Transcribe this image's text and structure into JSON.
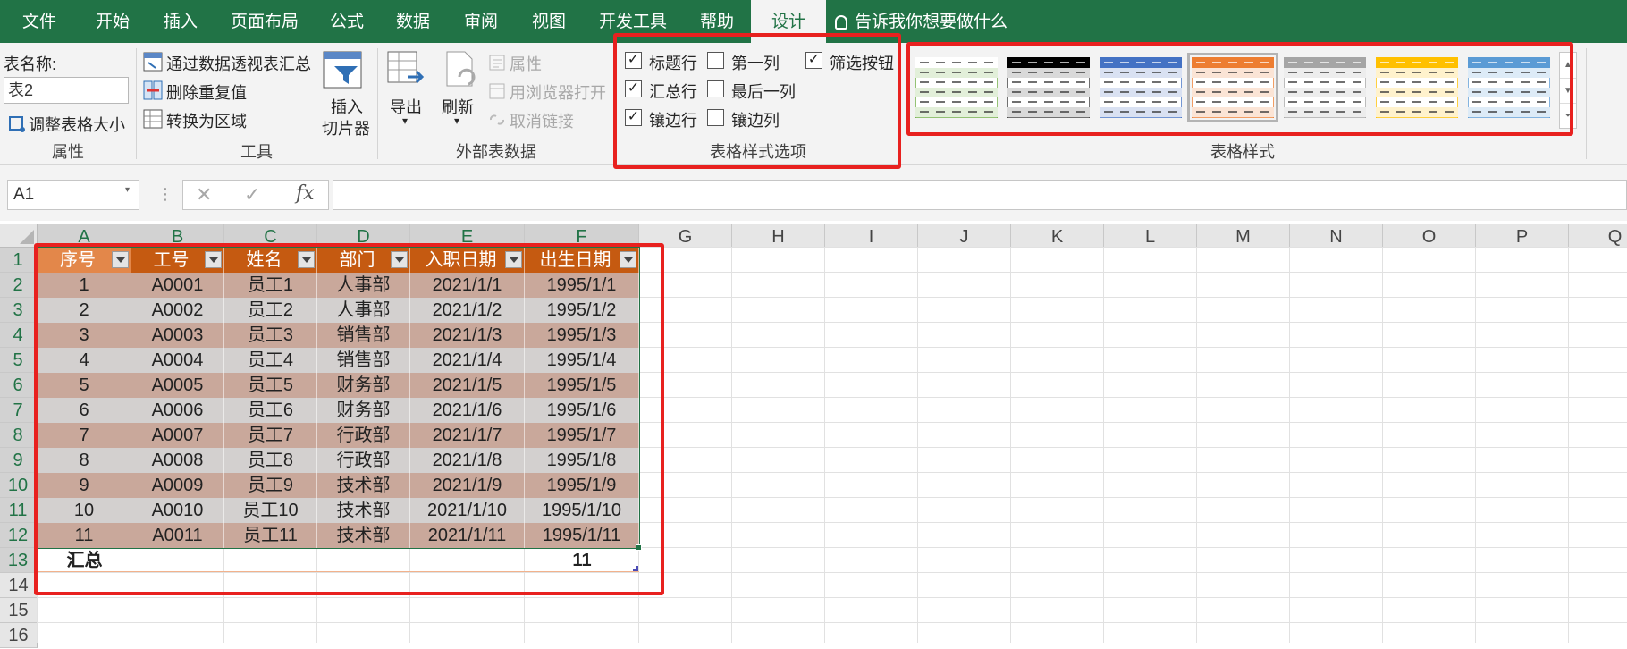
{
  "ribbon_tabs": [
    "文件",
    "开始",
    "插入",
    "页面布局",
    "公式",
    "数据",
    "审阅",
    "视图",
    "开发工具",
    "帮助",
    "设计"
  ],
  "tell_me": "告诉我你想要做什么",
  "properties": {
    "table_name_label": "表名称:",
    "table_name_value": "表2",
    "resize_label": "调整表格大小",
    "group_label": "属性"
  },
  "tools": {
    "pivot": "通过数据透视表汇总",
    "remove_dup": "删除重复值",
    "convert": "转换为区域",
    "slicer_line1": "插入",
    "slicer_line2": "切片器",
    "group_label": "工具"
  },
  "external": {
    "export": "导出",
    "refresh": "刷新",
    "properties": "属性",
    "open_browser": "用浏览器打开",
    "unlink": "取消链接",
    "group_label": "外部表数据"
  },
  "style_options": {
    "group_label": "表格样式选项",
    "options": [
      {
        "label": "标题行",
        "checked": true
      },
      {
        "label": "汇总行",
        "checked": true
      },
      {
        "label": "镶边行",
        "checked": true
      },
      {
        "label": "第一列",
        "checked": false
      },
      {
        "label": "最后一列",
        "checked": false
      },
      {
        "label": "镶边列",
        "checked": false
      },
      {
        "label": "筛选按钮",
        "checked": true
      }
    ]
  },
  "table_styles": {
    "group_label": "表格样式",
    "swatches": [
      {
        "name": "green",
        "head": "#ffffff",
        "band": "#e2efd9",
        "line": "#70ad47"
      },
      {
        "name": "black",
        "head": "#000000",
        "band": "#d9d9d9",
        "line": "#404040"
      },
      {
        "name": "blue",
        "head": "#4472c4",
        "band": "#d9e1f2",
        "line": "#4472c4"
      },
      {
        "name": "orange",
        "head": "#ed7d31",
        "band": "#fbe4d5",
        "line": "#ed7d31"
      },
      {
        "name": "gray",
        "head": "#a5a5a5",
        "band": "#ededed",
        "line": "#a5a5a5"
      },
      {
        "name": "gold",
        "head": "#ffc000",
        "band": "#fff2cc",
        "line": "#ffc000"
      },
      {
        "name": "lightblue",
        "head": "#5b9bd5",
        "band": "#ddebf7",
        "line": "#5b9bd5"
      }
    ]
  },
  "namebox": "A1",
  "columns": [
    "A",
    "B",
    "C",
    "D",
    "E",
    "F",
    "G",
    "H",
    "I",
    "J",
    "K",
    "L",
    "M",
    "N",
    "O",
    "P",
    "Q"
  ],
  "rows": [
    "1",
    "2",
    "3",
    "4",
    "5",
    "6",
    "7",
    "8",
    "9",
    "10",
    "11",
    "12",
    "13",
    "14",
    "15",
    "16"
  ],
  "table": {
    "headers": [
      "序号",
      "工号",
      "姓名",
      "部门",
      "入职日期",
      "出生日期"
    ],
    "rows": [
      [
        "1",
        "A0001",
        "员工1",
        "人事部",
        "2021/1/1",
        "1995/1/1"
      ],
      [
        "2",
        "A0002",
        "员工2",
        "人事部",
        "2021/1/2",
        "1995/1/2"
      ],
      [
        "3",
        "A0003",
        "员工3",
        "销售部",
        "2021/1/3",
        "1995/1/3"
      ],
      [
        "4",
        "A0004",
        "员工4",
        "销售部",
        "2021/1/4",
        "1995/1/4"
      ],
      [
        "5",
        "A0005",
        "员工5",
        "财务部",
        "2021/1/5",
        "1995/1/5"
      ],
      [
        "6",
        "A0006",
        "员工6",
        "财务部",
        "2021/1/6",
        "1995/1/6"
      ],
      [
        "7",
        "A0007",
        "员工7",
        "行政部",
        "2021/1/7",
        "1995/1/7"
      ],
      [
        "8",
        "A0008",
        "员工8",
        "行政部",
        "2021/1/8",
        "1995/1/8"
      ],
      [
        "9",
        "A0009",
        "员工9",
        "技术部",
        "2021/1/9",
        "1995/1/9"
      ],
      [
        "10",
        "A0010",
        "员工10",
        "技术部",
        "2021/1/10",
        "1995/1/10"
      ],
      [
        "11",
        "A0011",
        "员工11",
        "技术部",
        "2021/1/11",
        "1995/1/11"
      ]
    ],
    "total_label": "汇总",
    "total_value": "11"
  },
  "colors": {
    "ribbon": "#217346",
    "header_fill": "#c55a11",
    "band_a": "#c9a89b",
    "band_b": "#d3d0cf",
    "highlight": "#e8211f"
  }
}
